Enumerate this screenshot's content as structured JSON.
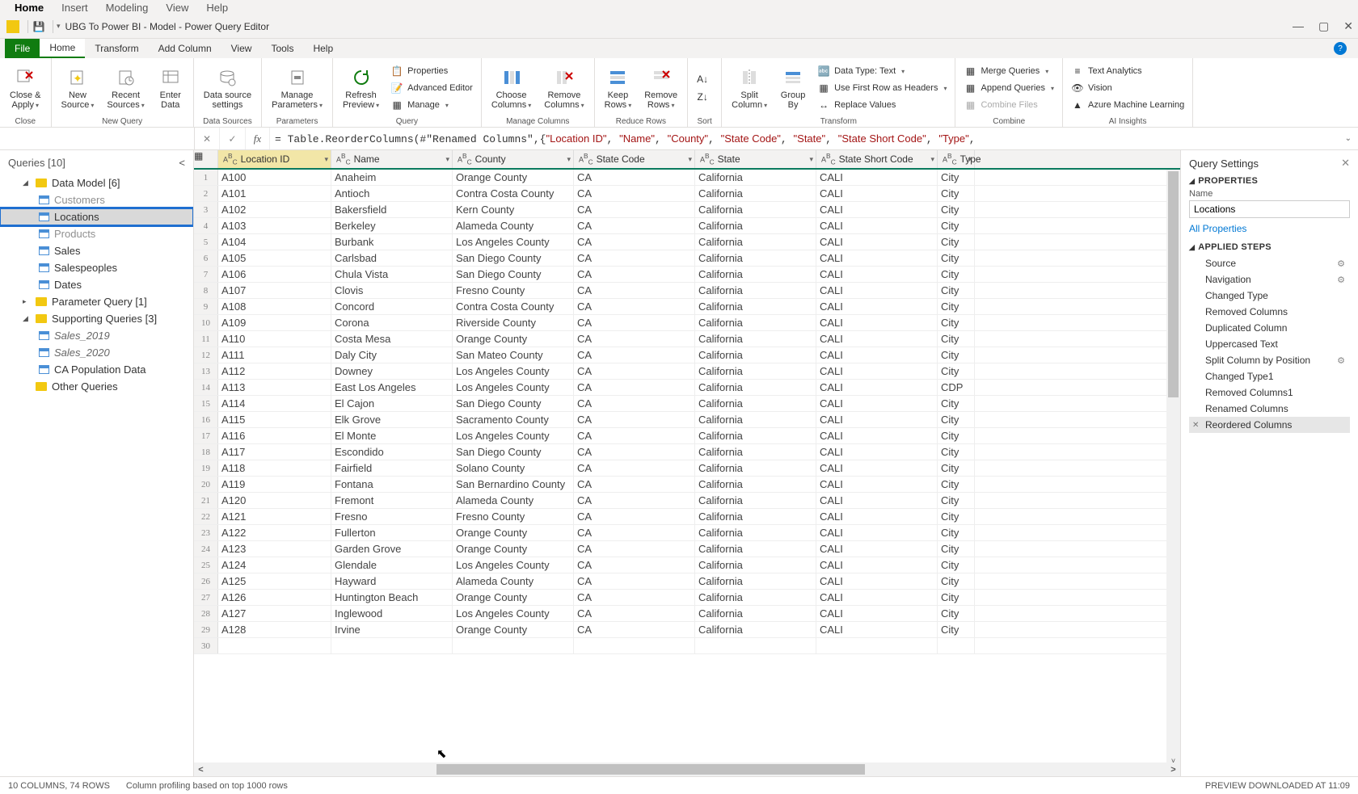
{
  "top_menu": [
    "Home",
    "Insert",
    "Modeling",
    "View",
    "Help"
  ],
  "title": "UBG To Power BI - Model - Power Query Editor",
  "ribbon_tabs": {
    "file": "File",
    "tabs": [
      "Home",
      "Transform",
      "Add Column",
      "View",
      "Tools",
      "Help"
    ],
    "active": "Home"
  },
  "ribbon": {
    "groups": [
      {
        "label": "Close",
        "buttons": [
          {
            "label": "Close &\nApply",
            "drop": true
          }
        ]
      },
      {
        "label": "New Query",
        "buttons": [
          {
            "label": "New\nSource",
            "drop": true
          },
          {
            "label": "Recent\nSources",
            "drop": true
          },
          {
            "label": "Enter\nData"
          }
        ]
      },
      {
        "label": "Data Sources",
        "buttons": [
          {
            "label": "Data source\nsettings"
          }
        ]
      },
      {
        "label": "Parameters",
        "buttons": [
          {
            "label": "Manage\nParameters",
            "drop": true
          }
        ]
      },
      {
        "label": "Query",
        "big": {
          "label": "Refresh\nPreview",
          "drop": true
        },
        "small": [
          "Properties",
          "Advanced Editor",
          "Manage"
        ]
      },
      {
        "label": "Manage Columns",
        "buttons": [
          {
            "label": "Choose\nColumns",
            "drop": true
          },
          {
            "label": "Remove\nColumns",
            "drop": true
          }
        ]
      },
      {
        "label": "Reduce Rows",
        "buttons": [
          {
            "label": "Keep\nRows",
            "drop": true
          },
          {
            "label": "Remove\nRows",
            "drop": true
          }
        ]
      },
      {
        "label": "Sort",
        "icons_only": true
      },
      {
        "label": "Transform",
        "big2": [
          {
            "label": "Split\nColumn",
            "drop": true
          },
          {
            "label": "Group\nBy"
          }
        ],
        "small": [
          "Data Type: Text",
          "Use First Row as Headers",
          "Replace Values"
        ]
      },
      {
        "label": "Combine",
        "small": [
          "Merge Queries",
          "Append Queries",
          "Combine Files"
        ]
      },
      {
        "label": "AI Insights",
        "small": [
          "Text Analytics",
          "Vision",
          "Azure Machine Learning"
        ]
      }
    ]
  },
  "formula": {
    "prefix": "= Table.ReorderColumns(#\"Renamed Columns\",{",
    "parts": [
      "\"Location ID\"",
      "\"Name\"",
      "\"County\"",
      "\"State Code\"",
      "\"State\"",
      "\"State Short Code\"",
      "\"Type\""
    ]
  },
  "queries": {
    "title": "Queries [10]",
    "tree": [
      {
        "type": "folder",
        "label": "Data Model [6]",
        "expanded": true
      },
      {
        "type": "table",
        "label": "Customers",
        "level": 2,
        "dim": true
      },
      {
        "type": "table",
        "label": "Locations",
        "level": 2,
        "selected": true
      },
      {
        "type": "table",
        "label": "Products",
        "level": 2,
        "dim": true
      },
      {
        "type": "table",
        "label": "Sales",
        "level": 2
      },
      {
        "type": "table",
        "label": "Salespeoples",
        "level": 2
      },
      {
        "type": "table",
        "label": "Dates",
        "level": 2
      },
      {
        "type": "folder",
        "label": "Parameter Query [1]",
        "expanded": false
      },
      {
        "type": "folder",
        "label": "Supporting Queries [3]",
        "expanded": true
      },
      {
        "type": "table",
        "label": "Sales_2019",
        "level": 2,
        "italic": true
      },
      {
        "type": "table",
        "label": "Sales_2020",
        "level": 2,
        "italic": true
      },
      {
        "type": "table",
        "label": "CA Population Data",
        "level": 2
      },
      {
        "type": "folder",
        "label": "Other Queries",
        "expanded": false,
        "noCaret": true
      }
    ]
  },
  "grid": {
    "columns": [
      "Location ID",
      "Name",
      "County",
      "State Code",
      "State",
      "State Short Code",
      "Type"
    ],
    "selected_col": 0,
    "rows": [
      [
        "A100",
        "Anaheim",
        "Orange County",
        "CA",
        "California",
        "CALI",
        "City"
      ],
      [
        "A101",
        "Antioch",
        "Contra Costa County",
        "CA",
        "California",
        "CALI",
        "City"
      ],
      [
        "A102",
        "Bakersfield",
        "Kern County",
        "CA",
        "California",
        "CALI",
        "City"
      ],
      [
        "A103",
        "Berkeley",
        "Alameda County",
        "CA",
        "California",
        "CALI",
        "City"
      ],
      [
        "A104",
        "Burbank",
        "Los Angeles County",
        "CA",
        "California",
        "CALI",
        "City"
      ],
      [
        "A105",
        "Carlsbad",
        "San Diego County",
        "CA",
        "California",
        "CALI",
        "City"
      ],
      [
        "A106",
        "Chula Vista",
        "San Diego County",
        "CA",
        "California",
        "CALI",
        "City"
      ],
      [
        "A107",
        "Clovis",
        "Fresno County",
        "CA",
        "California",
        "CALI",
        "City"
      ],
      [
        "A108",
        "Concord",
        "Contra Costa County",
        "CA",
        "California",
        "CALI",
        "City"
      ],
      [
        "A109",
        "Corona",
        "Riverside County",
        "CA",
        "California",
        "CALI",
        "City"
      ],
      [
        "A110",
        "Costa Mesa",
        "Orange County",
        "CA",
        "California",
        "CALI",
        "City"
      ],
      [
        "A111",
        "Daly City",
        "San Mateo County",
        "CA",
        "California",
        "CALI",
        "City"
      ],
      [
        "A112",
        "Downey",
        "Los Angeles County",
        "CA",
        "California",
        "CALI",
        "City"
      ],
      [
        "A113",
        "East Los Angeles",
        "Los Angeles County",
        "CA",
        "California",
        "CALI",
        "CDP"
      ],
      [
        "A114",
        "El Cajon",
        "San Diego County",
        "CA",
        "California",
        "CALI",
        "City"
      ],
      [
        "A115",
        "Elk Grove",
        "Sacramento County",
        "CA",
        "California",
        "CALI",
        "City"
      ],
      [
        "A116",
        "El Monte",
        "Los Angeles County",
        "CA",
        "California",
        "CALI",
        "City"
      ],
      [
        "A117",
        "Escondido",
        "San Diego County",
        "CA",
        "California",
        "CALI",
        "City"
      ],
      [
        "A118",
        "Fairfield",
        "Solano County",
        "CA",
        "California",
        "CALI",
        "City"
      ],
      [
        "A119",
        "Fontana",
        "San Bernardino County",
        "CA",
        "California",
        "CALI",
        "City"
      ],
      [
        "A120",
        "Fremont",
        "Alameda County",
        "CA",
        "California",
        "CALI",
        "City"
      ],
      [
        "A121",
        "Fresno",
        "Fresno County",
        "CA",
        "California",
        "CALI",
        "City"
      ],
      [
        "A122",
        "Fullerton",
        "Orange County",
        "CA",
        "California",
        "CALI",
        "City"
      ],
      [
        "A123",
        "Garden Grove",
        "Orange County",
        "CA",
        "California",
        "CALI",
        "City"
      ],
      [
        "A124",
        "Glendale",
        "Los Angeles County",
        "CA",
        "California",
        "CALI",
        "City"
      ],
      [
        "A125",
        "Hayward",
        "Alameda County",
        "CA",
        "California",
        "CALI",
        "City"
      ],
      [
        "A126",
        "Huntington Beach",
        "Orange County",
        "CA",
        "California",
        "CALI",
        "City"
      ],
      [
        "A127",
        "Inglewood",
        "Los Angeles County",
        "CA",
        "California",
        "CALI",
        "City"
      ],
      [
        "A128",
        "Irvine",
        "Orange County",
        "CA",
        "California",
        "CALI",
        "City"
      ],
      [
        "",
        "",
        "",
        "",
        "",
        "",
        ""
      ]
    ]
  },
  "settings": {
    "title": "Query Settings",
    "properties_label": "PROPERTIES",
    "name_label": "Name",
    "name_value": "Locations",
    "all_props": "All Properties",
    "steps_label": "APPLIED STEPS",
    "steps": [
      {
        "label": "Source",
        "gear": true
      },
      {
        "label": "Navigation",
        "gear": true
      },
      {
        "label": "Changed Type"
      },
      {
        "label": "Removed Columns"
      },
      {
        "label": "Duplicated Column"
      },
      {
        "label": "Uppercased Text"
      },
      {
        "label": "Split Column by Position",
        "gear": true
      },
      {
        "label": "Changed Type1"
      },
      {
        "label": "Removed Columns1"
      },
      {
        "label": "Renamed Columns"
      },
      {
        "label": "Reordered Columns",
        "selected": true,
        "x": true
      }
    ]
  },
  "status": {
    "left": "10 COLUMNS, 74 ROWS",
    "mid": "Column profiling based on top 1000 rows",
    "right": "PREVIEW DOWNLOADED AT 11:09"
  }
}
